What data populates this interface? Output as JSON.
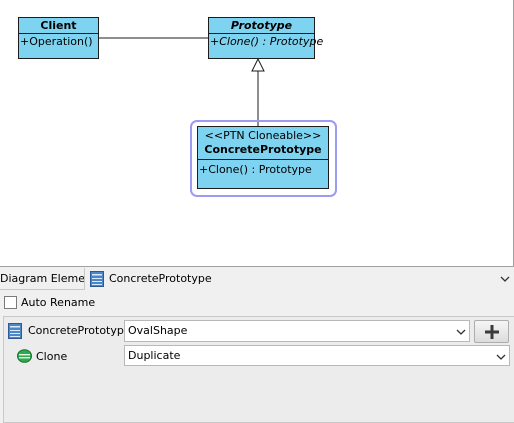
{
  "diagram": {
    "client": {
      "title": "Client",
      "operation": "+Operation()"
    },
    "prototype": {
      "title": "Prototype",
      "operation": "+Clone() : Prototype"
    },
    "concrete": {
      "stereotype": "<<PTN Cloneable>>",
      "title": "ConcretePrototype",
      "operation": "+Clone() : Prototype"
    },
    "colors": {
      "class_fill": "#7ed3f0",
      "selection": "#9b9bf0"
    }
  },
  "panel": {
    "diagram_element_label": "Diagram Element",
    "diagram_element_value": "ConcretePrototype",
    "auto_rename_label": "Auto Rename",
    "auto_rename_checked": false,
    "rows": [
      {
        "name": "ConcretePrototype",
        "value": "OvalShape",
        "icon": "class-icon"
      },
      {
        "name": "Clone",
        "value": "Duplicate",
        "icon": "operation-icon"
      }
    ]
  }
}
